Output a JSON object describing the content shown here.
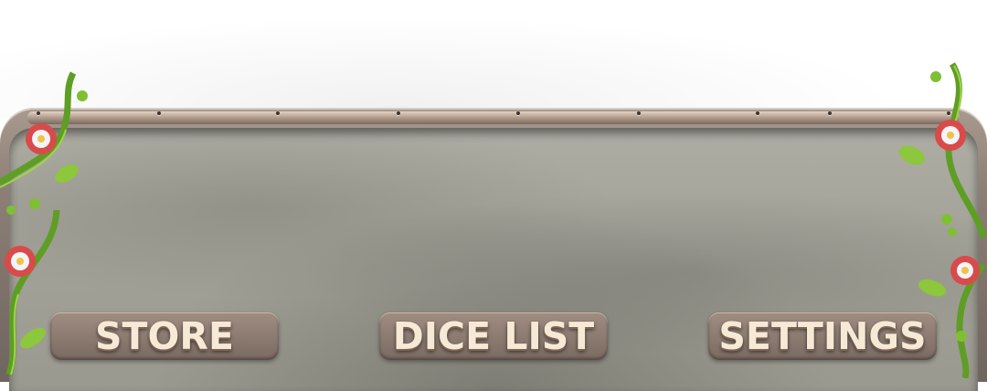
{
  "menu": {
    "store_label": "STORE",
    "dice_list_label": "DICE LIST",
    "settings_label": "SETTINGS"
  },
  "colors": {
    "button_fill": "#8b7a70",
    "button_text": "#f6ead7",
    "metal_panel": "#a4a39a",
    "frame": "#8d7f76",
    "vine": "#6fae2e",
    "flower": "#e05555"
  }
}
